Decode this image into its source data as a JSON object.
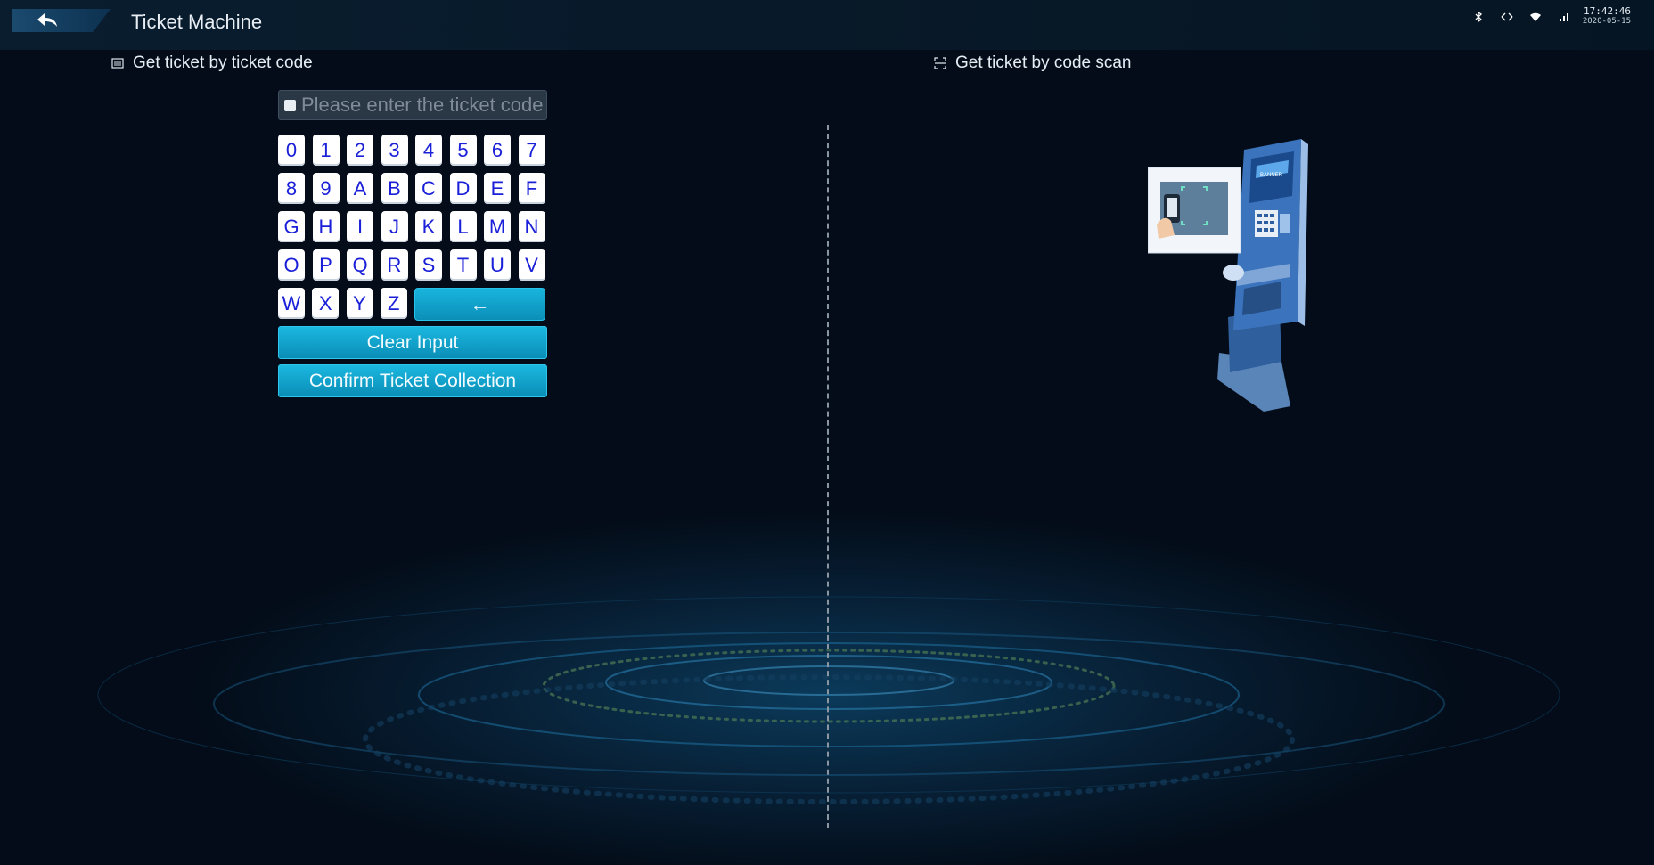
{
  "header": {
    "title": "Ticket Machine",
    "back_icon": "back-arrow-icon",
    "status_icons": [
      "bluetooth-icon",
      "usb-icon",
      "wifi-icon",
      "signal-icon"
    ],
    "time": "17:42:46",
    "date": "2020-05-15"
  },
  "left_section": {
    "title": "Get ticket by ticket code",
    "icon": "barcode-icon",
    "input": {
      "value": "",
      "placeholder": "Please enter the ticket code"
    },
    "keys": [
      [
        "0",
        "1",
        "2",
        "3",
        "4",
        "5",
        "6",
        "7"
      ],
      [
        "8",
        "9",
        "A",
        "B",
        "C",
        "D",
        "E",
        "F"
      ],
      [
        "G",
        "H",
        "I",
        "J",
        "K",
        "L",
        "M",
        "N"
      ],
      [
        "O",
        "P",
        "Q",
        "R",
        "S",
        "T",
        "U",
        "V"
      ],
      [
        "W",
        "X",
        "Y",
        "Z"
      ]
    ],
    "backspace_label": "←",
    "clear_label": "Clear Input",
    "confirm_label": "Confirm Ticket Collection"
  },
  "right_section": {
    "title": "Get ticket by code scan",
    "icon": "scan-icon",
    "kiosk_banner": "BANNER"
  },
  "colors": {
    "accent": "#12a7d2",
    "key_text": "#1a20d8",
    "background": "#030c18"
  }
}
